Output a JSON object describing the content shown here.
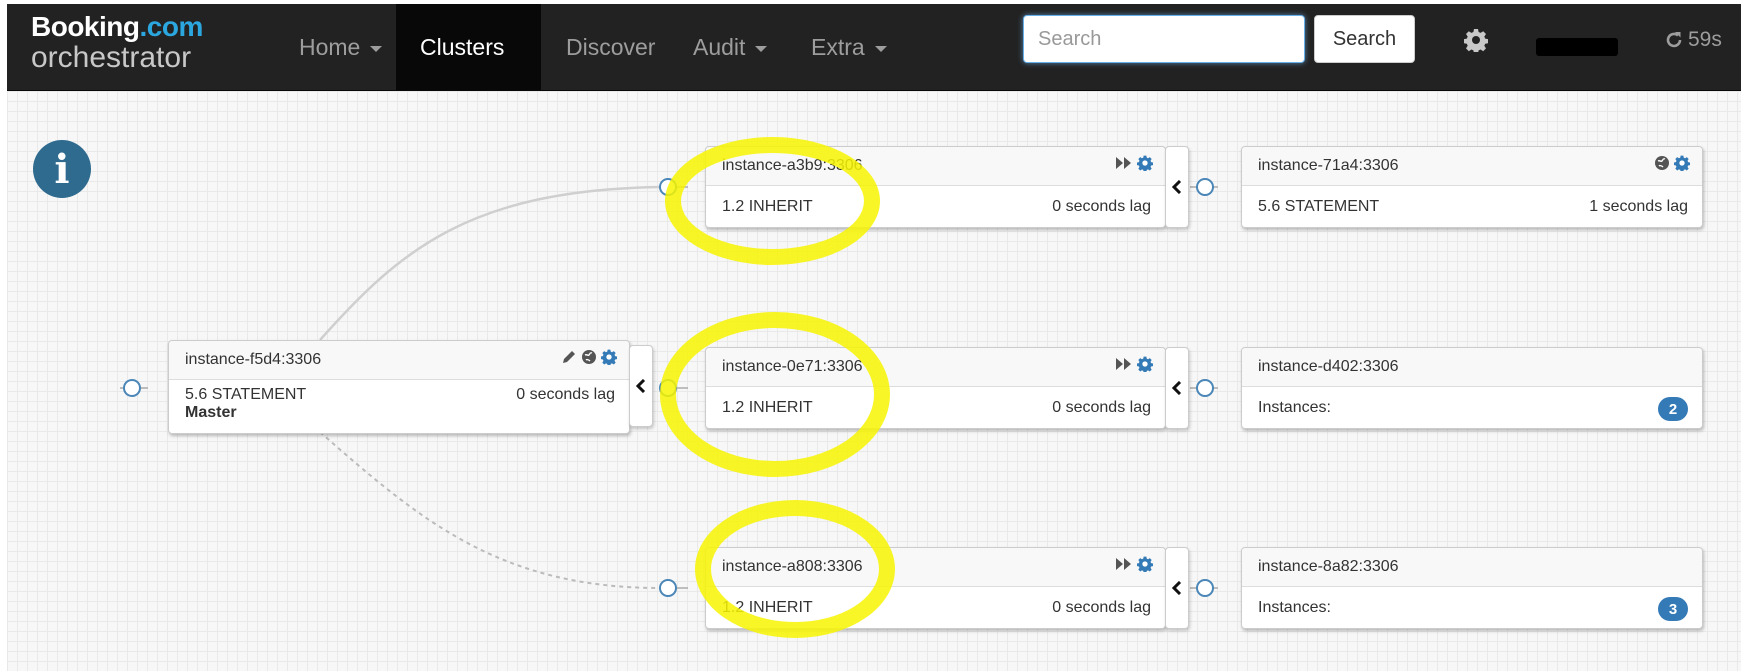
{
  "brand": {
    "name": "Booking",
    "tld": ".com",
    "product": "orchestrator"
  },
  "nav": {
    "home": "Home",
    "clusters": "Clusters",
    "discover": "Discover",
    "audit": "Audit",
    "extra": "Extra"
  },
  "search": {
    "placeholder": "Search",
    "button": "Search"
  },
  "refresh": {
    "countdown": "59s"
  },
  "instances": {
    "master": {
      "name": "instance-f5d4:3306",
      "version": "5.6 STATEMENT",
      "lag": "0 seconds lag",
      "role": "Master"
    },
    "a3b9": {
      "name": "instance-a3b9:3306",
      "version": "1.2 INHERIT",
      "lag": "0 seconds lag"
    },
    "i0e71": {
      "name": "instance-0e71:3306",
      "version": "1.2 INHERIT",
      "lag": "0 seconds lag"
    },
    "a808": {
      "name": "instance-a808:3306",
      "version": "1.2 INHERIT",
      "lag": "0 seconds lag"
    },
    "i71a4": {
      "name": "instance-71a4:3306",
      "version": "5.6 STATEMENT",
      "lag": "1 seconds lag"
    },
    "d402": {
      "name": "instance-d402:3306",
      "label": "Instances:",
      "count": "2"
    },
    "i8a82": {
      "name": "instance-8a82:3306",
      "label": "Instances:",
      "count": "3"
    }
  },
  "colors": {
    "navbar": "#222222",
    "accent_blue": "#337ab7",
    "highlight": "#f7f500",
    "brand_dotcom": "#2ba6de"
  }
}
